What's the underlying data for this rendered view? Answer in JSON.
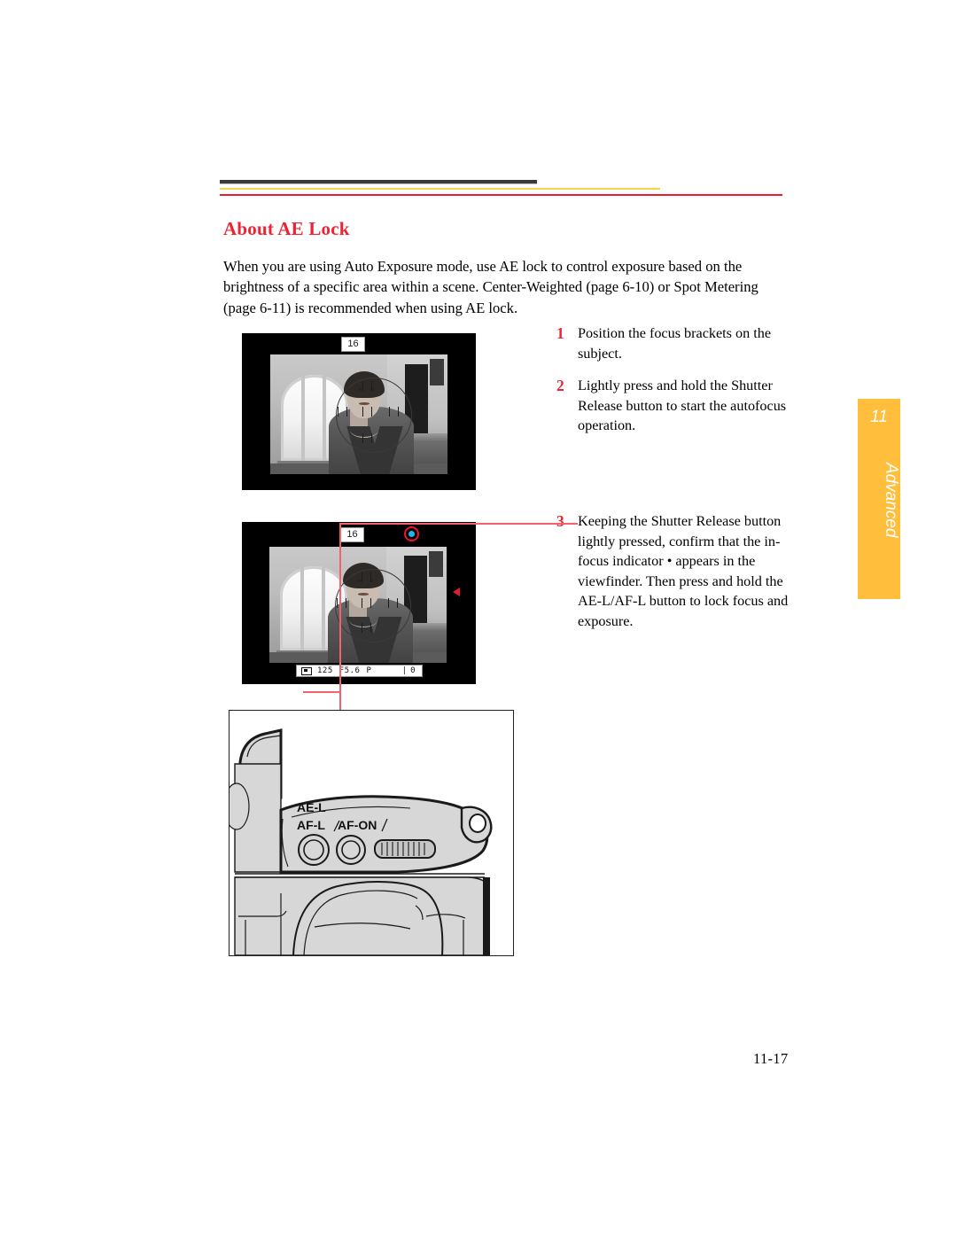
{
  "document": {
    "heading": "About AE Lock",
    "intro": "When you are using Auto Exposure mode, use AE lock to control exposure based on the brightness of a specific area within a scene. Center-Weighted (page 6-10) or Spot Metering (page 6-11) is recommended when using AE lock.",
    "page_number": "11-17"
  },
  "rules": {
    "dark_color": "#3a3a3a",
    "gold_color": "#f6d44c",
    "red_color": "#ed1c2e"
  },
  "colors": {
    "heading_red": "#ee2233",
    "step_number_red": "#ee2233",
    "tab_orange": "#ffbe3c",
    "callout_red": "#f4616e",
    "indicator_ring_red": "#ee1133",
    "indicator_dot_cyan": "#20b6e8",
    "triangle_red": "#e21b34"
  },
  "steps": [
    {
      "number": "1",
      "text": "Position the focus brackets on the subject."
    },
    {
      "number": "2",
      "text": "Lightly press and hold the Shutter Release button to start the autofocus operation."
    },
    {
      "number": "3",
      "text": "Keeping the Shutter Release button lightly pressed, confirm that the in-focus indicator • appears in the viewfinder. Then press and hold the AE-L/AF-L button to lock focus and exposure."
    }
  ],
  "viewfinder_one": {
    "frame_counter": "16"
  },
  "viewfinder_two": {
    "frame_counter": "16",
    "status_bar": {
      "shutter_speed": "125",
      "aperture": "F5.6",
      "exposure_mode": "P",
      "frames_remaining": "0"
    }
  },
  "camera_diagram": {
    "labels": {
      "ae_lock": "AE-L",
      "af_lock": "AF-L",
      "af_on": "AF-ON"
    }
  },
  "side_tab": {
    "chapter": "11",
    "label": "Advanced"
  }
}
